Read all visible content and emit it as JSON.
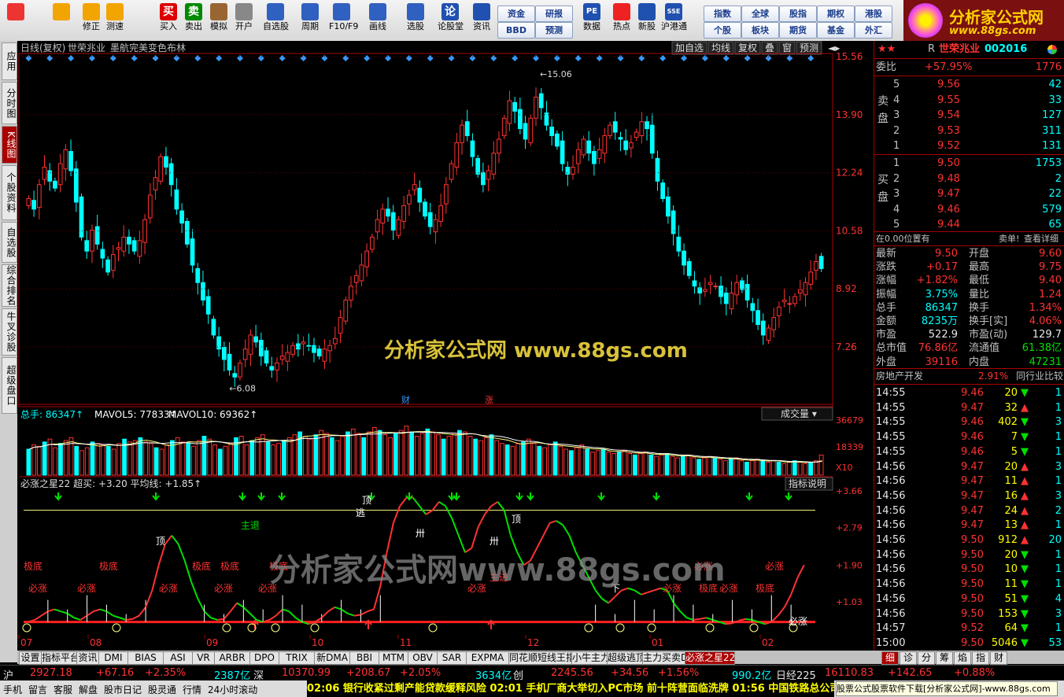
{
  "toolbar": {
    "buttons": [
      {
        "label": "",
        "icon": "grid-icon"
      },
      {
        "label": "",
        "icon": "back-arrow-icon"
      },
      {
        "label": "修正",
        "icon": "up-down-icon"
      },
      {
        "label": "测速",
        "icon": "clock-icon"
      },
      {
        "label": "买入",
        "icon": "buy-icon",
        "glyph": "买"
      },
      {
        "label": "卖出",
        "icon": "sell-icon",
        "glyph": "卖"
      },
      {
        "label": "模拟",
        "icon": "hammer-icon"
      },
      {
        "label": "开户",
        "icon": "lock-icon"
      },
      {
        "label": "自选股",
        "icon": "star-icon"
      },
      {
        "label": "周期",
        "icon": "cycle-icon"
      },
      {
        "label": "F10/F9",
        "icon": "f10-icon"
      },
      {
        "label": "画线",
        "icon": "pencil-icon"
      },
      {
        "label": "选股",
        "icon": "select-stock-icon"
      },
      {
        "label": "论股堂",
        "icon": "forum-icon",
        "glyph": "论"
      },
      {
        "label": "资讯",
        "icon": "news-icon"
      },
      {
        "label": "数据",
        "icon": "pe-icon",
        "glyph": "PE"
      },
      {
        "label": "热点",
        "icon": "hot-icon"
      },
      {
        "label": "新股",
        "icon": "new-stock-icon"
      },
      {
        "label": "沪港通",
        "icon": "shhk-icon",
        "glyph": "SSE"
      }
    ],
    "small_buttons": [
      "资金",
      "研报",
      "BBD",
      "预测",
      "指数",
      "全球",
      "股指",
      "期权",
      "港股",
      "个股",
      "板块",
      "期货",
      "基金",
      "外汇"
    ]
  },
  "logo": {
    "line1": "分析家公式网",
    "line2": "www.88gs.com"
  },
  "left_tabs": [
    "应用",
    "分时图",
    "K线图",
    "个股资料",
    "自选股",
    "综合排名",
    "牛叉诊股",
    "超级盘口"
  ],
  "chart_header": {
    "period": "日线(复权)",
    "stock_name": "世荣兆业",
    "indicator": "墨航完美变色布林",
    "menu": [
      "加自选",
      "均线",
      "复权",
      "叠",
      "窗",
      "预测"
    ]
  },
  "watermarks": [
    "分析家公式网 www.88gs.com",
    "分析家公式网www.88gs.com"
  ],
  "chart_data": [
    {
      "type": "candlestick",
      "y_ticks": [
        15.56,
        13.9,
        12.24,
        10.58,
        8.92,
        7.26
      ],
      "ylim": [
        6.0,
        15.56
      ],
      "max_label": "15.06",
      "min_label": "6.08",
      "markers": [
        "财",
        "涨"
      ],
      "closes": [
        11.5,
        11.2,
        11.9,
        12.4,
        12.0,
        11.8,
        12.5,
        12.9,
        12.3,
        11.4,
        10.4,
        10.0,
        10.6,
        10.2,
        9.8,
        9.4,
        9.9,
        10.1,
        10.4,
        10.2,
        10.0,
        10.3,
        10.9,
        11.6,
        12.1,
        12.7,
        12.4,
        11.9,
        11.2,
        10.8,
        10.2,
        9.6,
        9.1,
        8.6,
        8.2,
        7.6,
        7.2,
        6.9,
        6.6,
        6.4,
        6.8,
        7.2,
        7.6,
        7.4,
        7.0,
        6.8,
        6.6,
        6.8,
        7.0,
        7.1,
        7.3,
        7.2,
        7.4,
        7.3,
        7.1,
        7.0,
        7.2,
        7.3,
        7.5,
        8.1,
        8.6,
        9.0,
        9.3,
        9.6,
        10.0,
        10.4,
        10.9,
        11.2,
        11.0,
        10.6,
        10.9,
        11.3,
        11.6,
        11.9,
        11.4,
        11.0,
        10.7,
        10.9,
        11.3,
        11.9,
        12.5,
        13.1,
        13.6,
        13.3,
        12.7,
        12.2,
        11.9,
        12.3,
        12.8,
        13.2,
        13.8,
        14.3,
        14.0,
        13.5,
        13.2,
        13.8,
        14.4,
        14.1,
        13.6,
        13.3,
        13.0,
        12.5,
        12.2,
        12.4,
        12.9,
        13.2,
        12.8,
        12.5,
        12.9,
        13.3,
        13.6,
        13.4,
        13.2,
        12.9,
        13.1,
        13.4,
        13.7,
        13.5,
        12.8,
        12.0,
        11.5,
        11.0,
        10.5,
        10.0,
        9.6,
        9.3,
        9.0,
        8.8,
        8.9,
        9.1,
        9.0,
        8.7,
        8.5,
        8.8,
        9.1,
        8.9,
        8.6,
        8.3,
        7.9,
        7.6,
        7.8,
        8.1,
        8.4,
        8.6,
        8.5,
        8.7,
        8.9,
        9.1,
        9.4,
        9.7,
        9.5
      ]
    },
    {
      "type": "bar",
      "title": "总手",
      "legend": [
        {
          "name": "总手",
          "value": "86347"
        },
        {
          "name": "MAVOL5",
          "value": "77833"
        },
        {
          "name": "MAVOL10",
          "value": "69362"
        }
      ],
      "label": "成交量",
      "y_ticks": [
        "36679",
        "18339",
        "X10"
      ],
      "values": [
        18,
        21,
        20,
        23,
        25,
        19,
        22,
        24,
        26,
        20,
        17,
        19,
        23,
        22,
        21,
        20,
        18,
        22,
        25,
        23,
        24,
        26,
        23,
        22,
        19,
        18,
        21,
        24,
        26,
        23,
        22,
        20,
        24,
        27,
        25,
        21,
        18,
        20,
        22,
        26,
        27,
        21,
        24,
        26,
        28,
        23,
        21,
        22,
        24,
        26,
        28,
        30,
        27,
        25,
        28,
        31,
        29,
        26,
        24,
        27,
        30,
        32,
        29,
        26,
        30,
        33,
        31,
        28,
        26,
        29,
        31,
        34,
        30,
        27,
        29,
        32,
        30,
        28,
        25,
        27,
        29,
        31,
        30,
        27,
        25,
        24,
        26,
        28,
        24,
        22,
        21,
        20,
        22,
        23,
        25,
        22,
        20,
        19,
        21,
        23,
        20,
        18,
        17,
        19,
        21,
        18,
        16,
        17,
        18,
        16,
        15,
        16,
        17,
        15,
        14,
        15,
        16,
        14,
        13,
        14,
        15,
        13,
        12,
        13,
        14,
        12,
        11,
        12,
        13,
        12,
        11,
        10,
        11,
        12,
        10,
        9,
        10,
        11,
        10,
        9,
        10,
        9,
        8,
        9,
        10,
        9,
        8,
        9,
        10,
        14
      ]
    },
    {
      "type": "line",
      "title": "必涨之星22",
      "legend": [
        {
          "name": "超买",
          "value": "+3.20"
        },
        {
          "name": "平均线",
          "value": "+1.85"
        }
      ],
      "label": "指标说明",
      "y_ticks": [
        "+3.66",
        "+2.79",
        "+1.90",
        "+1.03"
      ],
      "ylim": [
        0.3,
        3.66
      ],
      "buy_line": 3.2,
      "base_line": 0.55,
      "values": [
        0.55,
        0.6,
        0.7,
        0.8,
        0.85,
        0.8,
        0.75,
        0.65,
        0.6,
        0.7,
        0.8,
        0.85,
        0.8,
        0.7,
        0.65,
        0.6,
        0.62,
        0.7,
        0.9,
        1.3,
        1.9,
        2.4,
        2.6,
        2.4,
        2.0,
        1.5,
        1.1,
        0.8,
        0.65,
        0.6,
        0.62,
        0.8,
        1.0,
        0.9,
        0.75,
        0.6,
        0.55,
        0.6,
        0.7,
        0.85,
        0.8,
        0.65,
        0.55,
        0.5,
        0.55,
        0.65,
        0.8,
        0.9,
        0.85,
        0.75,
        0.7,
        0.72,
        0.8,
        0.85,
        1.4,
        2.2,
        2.9,
        3.3,
        3.5,
        3.5,
        3.3,
        3.1,
        3.2,
        3.4,
        3.3,
        3.0,
        2.6,
        2.2,
        2.3,
        2.8,
        3.1,
        3.3,
        3.4,
        3.2,
        2.6,
        2.2,
        1.9,
        2.0,
        2.3,
        2.6,
        2.9,
        2.95,
        2.85,
        2.6,
        2.2,
        1.9,
        1.6,
        1.3,
        1.1,
        1.0,
        1.15,
        1.3,
        1.35,
        1.3,
        1.2,
        1.25,
        1.3,
        1.35,
        1.3,
        1.0,
        0.8,
        0.65,
        0.6,
        0.62,
        0.65,
        0.6,
        0.55,
        0.5,
        0.52,
        0.58,
        0.62,
        0.6,
        0.55,
        0.5,
        0.55,
        0.7,
        0.9,
        1.2,
        1.6,
        1.9
      ],
      "labels": [
        "极底",
        "必涨",
        "极底",
        "必涨",
        "顶",
        "必涨",
        "极底",
        "极底",
        "必涨",
        "极底",
        "必涨",
        "主退",
        "逃",
        "顶",
        "卅",
        "必涨",
        "卅",
        "主进",
        "顶",
        "必涨",
        "下",
        "必涨",
        "极底",
        "必涨",
        "极底",
        "必涨",
        "必涨"
      ]
    }
  ],
  "bottom_tabs": [
    "设置",
    "指标平台",
    "资讯",
    "DMI",
    "BIAS",
    "ASI",
    "VR",
    "ARBR",
    "DPO",
    "TRIX",
    "新DMA",
    "BBI",
    "MTM",
    "OBV",
    "SAR",
    "EXPMA",
    "同花顺短线王指标",
    "小牛主力",
    "超级逃顶",
    "主力买卖D",
    "必涨之星22"
  ],
  "bottom_right_tabs": [
    "细",
    "诊",
    "分",
    "筹",
    "焰",
    "指",
    "财"
  ],
  "x_axis_labels": [
    "07",
    "08",
    "09",
    "10",
    "11",
    "12",
    "01",
    "02"
  ],
  "right_panel": {
    "stars": "★★",
    "code_label": "R",
    "stock_name": "世荣兆业",
    "stock_code": "002016",
    "weibi_label": "委比",
    "weibi_pct": "+57.95%",
    "weibi_val": "1776",
    "sell_label": "卖盘",
    "buy_label": "买盘",
    "asks": [
      {
        "n": "5",
        "p": "9.56",
        "v": "42"
      },
      {
        "n": "4",
        "p": "9.55",
        "v": "33"
      },
      {
        "n": "3",
        "p": "9.54",
        "v": "127"
      },
      {
        "n": "2",
        "p": "9.53",
        "v": "311"
      },
      {
        "n": "1",
        "p": "9.52",
        "v": "131"
      }
    ],
    "bids": [
      {
        "n": "1",
        "p": "9.50",
        "v": "1753"
      },
      {
        "n": "2",
        "p": "9.48",
        "v": "2"
      },
      {
        "n": "3",
        "p": "9.47",
        "v": "22"
      },
      {
        "n": "4",
        "p": "9.46",
        "v": "579"
      },
      {
        "n": "5",
        "p": "9.44",
        "v": "65"
      }
    ],
    "pos_text": "在0.00位置有",
    "sell_text": "卖单!",
    "detail_text": "查看详细",
    "stats": [
      {
        "l1": "最新",
        "v1": "9.50",
        "l2": "开盘",
        "v2": "9.60"
      },
      {
        "l1": "涨跌",
        "v1": "+0.17",
        "l2": "最高",
        "v2": "9.75"
      },
      {
        "l1": "涨幅",
        "v1": "+1.82%",
        "l2": "最低",
        "v2": "9.40"
      },
      {
        "l1": "振幅",
        "v1": "3.75%",
        "l2": "量比",
        "v2": "1.24"
      },
      {
        "l1": "总手",
        "v1": "86347",
        "l2": "换手",
        "v2": "1.34%"
      },
      {
        "l1": "金额",
        "v1": "8235万",
        "l2": "换手[实]",
        "v2": "4.06%"
      },
      {
        "l1": "市盈",
        "v1": "522.9",
        "l2": "市盈(动)",
        "v2": "129.7"
      },
      {
        "l1": "总市值",
        "v1": "76.86亿",
        "l2": "流通值",
        "v2": "61.38亿"
      },
      {
        "l1": "外盘",
        "v1": "39116",
        "l2": "内盘",
        "v2": "47231"
      }
    ],
    "industry": "房地产开发",
    "industry_pct": "2.91%",
    "compare": "同行业比较",
    "ticks": [
      {
        "t": "14:55",
        "p": "9.46",
        "v": "20",
        "d": "down",
        "c": "1"
      },
      {
        "t": "14:55",
        "p": "9.47",
        "v": "32",
        "d": "up",
        "c": "1"
      },
      {
        "t": "14:55",
        "p": "9.46",
        "v": "402",
        "d": "down",
        "c": "3"
      },
      {
        "t": "14:55",
        "p": "9.46",
        "v": "7",
        "d": "down",
        "c": "1"
      },
      {
        "t": "14:55",
        "p": "9.46",
        "v": "5",
        "d": "down",
        "c": "1"
      },
      {
        "t": "14:56",
        "p": "9.47",
        "v": "20",
        "d": "up",
        "c": "3"
      },
      {
        "t": "14:56",
        "p": "9.47",
        "v": "11",
        "d": "up",
        "c": "1"
      },
      {
        "t": "14:56",
        "p": "9.47",
        "v": "16",
        "d": "up",
        "c": "3"
      },
      {
        "t": "14:56",
        "p": "9.47",
        "v": "24",
        "d": "up",
        "c": "2"
      },
      {
        "t": "14:56",
        "p": "9.47",
        "v": "13",
        "d": "up",
        "c": "1"
      },
      {
        "t": "14:56",
        "p": "9.50",
        "v": "912",
        "d": "up",
        "c": "20"
      },
      {
        "t": "14:56",
        "p": "9.50",
        "v": "20",
        "d": "down",
        "c": "1"
      },
      {
        "t": "14:56",
        "p": "9.50",
        "v": "10",
        "d": "down",
        "c": "1"
      },
      {
        "t": "14:56",
        "p": "9.50",
        "v": "11",
        "d": "down",
        "c": "1"
      },
      {
        "t": "14:56",
        "p": "9.50",
        "v": "51",
        "d": "down",
        "c": "4"
      },
      {
        "t": "14:56",
        "p": "9.50",
        "v": "153",
        "d": "down",
        "c": "3"
      },
      {
        "t": "14:57",
        "p": "9.52",
        "v": "64",
        "d": "down",
        "c": "1"
      },
      {
        "t": "15:00",
        "p": "9.50",
        "v": "5046",
        "d": "down",
        "c": "53"
      }
    ]
  },
  "status": {
    "sh_label": "沪",
    "sh_val": "2927.18",
    "sh_chg": "+67.16",
    "sh_pct": "+2.35%",
    "sh_amt": "2387亿",
    "sz_label": "深",
    "sz_val": "10370.99",
    "sz_chg": "+208.67",
    "sz_pct": "+2.05%",
    "sz_amt": "3634亿",
    "cy_label": "创",
    "cy_val": "2245.56",
    "cy_chg": "+34.56",
    "cy_pct": "+1.56%",
    "cy_amt": "990.2亿",
    "rj_label": "日经225",
    "rj_val": "16110.83",
    "rj_chg": "+142.65",
    "rj_pct": "+0.88%",
    "bar2_items": [
      "手机",
      "留言",
      "客服",
      "解盘",
      "股市日记",
      "股灵通",
      "行情",
      "24小时滚动"
    ],
    "news": "02:06 银行收紧过剩产能贷款缓释风险      02:01 手机厂商大举切入PC市场 前十阵营面临洗牌      01:56 中国铁路总公司拥抱资本",
    "popup": "股票公式股票软件下载[分析家公式网]-www.88gs.com"
  }
}
